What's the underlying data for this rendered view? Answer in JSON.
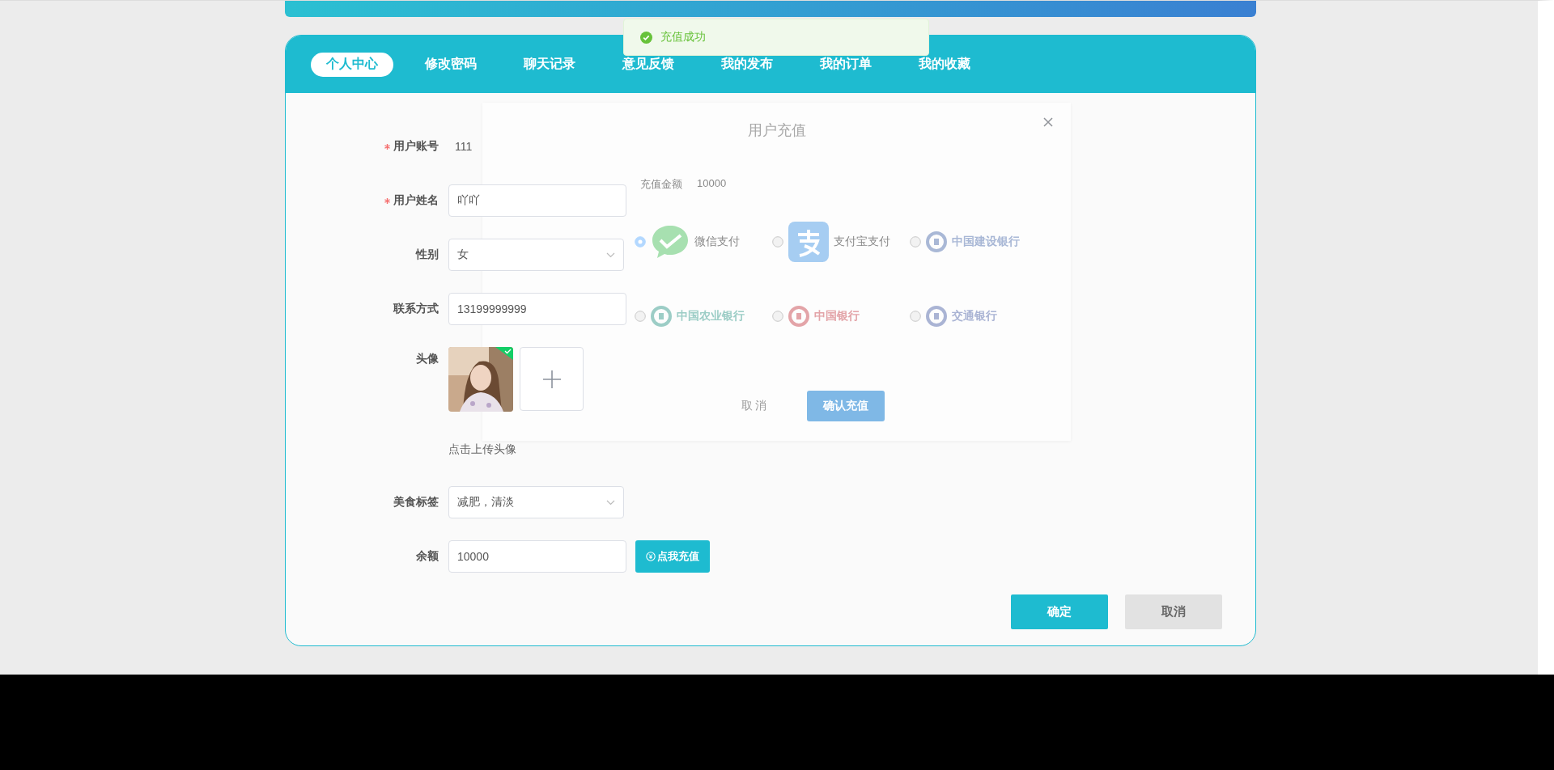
{
  "toast": {
    "kind": "success",
    "message": "充值成功"
  },
  "tabs": [
    {
      "label": "个人中心",
      "selected": true
    },
    {
      "label": "修改密码",
      "selected": false
    },
    {
      "label": "聊天记录",
      "selected": false
    },
    {
      "label": "意见反馈",
      "selected": false
    },
    {
      "label": "我的发布",
      "selected": false
    },
    {
      "label": "我的订单",
      "selected": false
    },
    {
      "label": "我的收藏",
      "selected": false
    }
  ],
  "form": {
    "fields": [
      {
        "kind": "text",
        "label": "用户账号",
        "required": true,
        "value": "111"
      },
      {
        "kind": "input",
        "label": "用户姓名",
        "required": true,
        "value": "吖吖"
      },
      {
        "kind": "select",
        "label": "性别",
        "required": false,
        "value": "女"
      },
      {
        "kind": "input",
        "label": "联系方式",
        "required": false,
        "value": "13199999999"
      },
      {
        "kind": "upload",
        "label": "头像",
        "required": false,
        "uploaded": true,
        "hint": "点击上传头像"
      },
      {
        "kind": "select",
        "label": "美食标签",
        "required": false,
        "value": "减肥，清淡"
      },
      {
        "kind": "input",
        "label": "余额",
        "required": false,
        "value": "10000",
        "action": "点我充值"
      }
    ],
    "buttons": [
      {
        "kind": "primary",
        "label": "确定"
      },
      {
        "kind": "default",
        "label": "取消"
      }
    ]
  },
  "dialog": {
    "title": "用户充值",
    "amount_label": "充值金额",
    "amount": "10000",
    "methods": [
      {
        "kind": "wechat",
        "label": "微信支付",
        "selected": true
      },
      {
        "kind": "alipay",
        "label": "支付宝支付",
        "selected": false
      },
      {
        "kind": "bank",
        "label": "中国建设银行",
        "selected": false,
        "color": "#a9b8d6"
      },
      {
        "kind": "bank",
        "label": "中国农业银行",
        "selected": false,
        "color": "#9ccdc6"
      },
      {
        "kind": "bank",
        "label": "中国银行",
        "selected": false,
        "color": "#e3a4a8"
      },
      {
        "kind": "bank",
        "label": "交通银行",
        "selected": false,
        "color": "#aab4d4"
      }
    ],
    "buttons": [
      {
        "kind": "default",
        "label": "取 消"
      },
      {
        "kind": "primary",
        "label": "确认充值"
      }
    ]
  }
}
